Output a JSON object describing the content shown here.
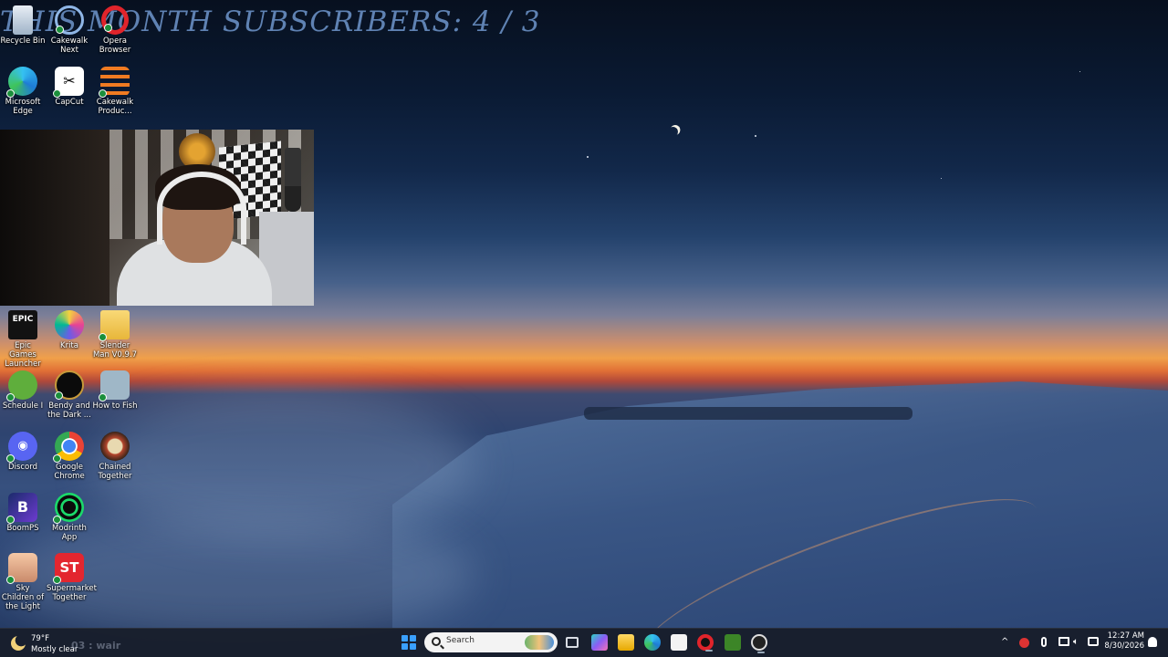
{
  "overlay": {
    "subscribers_text": "THIS MONTH SUBSCRIBERS: 4 / 3"
  },
  "desktop_icons": [
    {
      "label": "Recycle Bin",
      "icon": "recycle-bin-icon"
    },
    {
      "label": "Cakewalk Next",
      "icon": "cakewalk-next-icon"
    },
    {
      "label": "Opera Browser",
      "icon": "opera-icon"
    },
    {
      "label": "Microsoft Edge",
      "icon": "edge-icon"
    },
    {
      "label": "CapCut",
      "icon": "capcut-icon"
    },
    {
      "label": "Cakewalk Produc...",
      "icon": "cakewalk-producer-icon"
    },
    {
      "label": "Epic Games Launcher",
      "icon": "epic-games-icon"
    },
    {
      "label": "Krita",
      "icon": "krita-icon"
    },
    {
      "label": "Slender Man V0.9.7",
      "icon": "folder-icon"
    },
    {
      "label": "Schedule I",
      "icon": "schedule-i-icon"
    },
    {
      "label": "Bendy and the Dark ...",
      "icon": "bendy-icon"
    },
    {
      "label": "How to Fish",
      "icon": "how-to-fish-icon"
    },
    {
      "label": "Discord",
      "icon": "discord-icon"
    },
    {
      "label": "Google Chrome",
      "icon": "chrome-icon"
    },
    {
      "label": "Chained Together",
      "icon": "chained-together-icon"
    },
    {
      "label": "BoomPS",
      "icon": "boomps-icon"
    },
    {
      "label": "Modrinth App",
      "icon": "modrinth-icon"
    },
    {
      "label": "Sky Children of the Light",
      "icon": "sky-icon"
    },
    {
      "label": "Supermarket Together",
      "icon": "supermarket-together-icon"
    }
  ],
  "taskbar": {
    "weather_temp": "79°F",
    "weather_condition": "Mostly clear",
    "chat_ghost": "03 : wair",
    "search_placeholder": "Search",
    "start_icon": "windows-start-icon",
    "pinned_apps": [
      "task-view-icon",
      "copilot-icon",
      "file-explorer-icon",
      "edge-icon",
      "store-icon",
      "opera-gx-icon",
      "minecraft-icon",
      "obs-icon"
    ],
    "tray_chevron": "^",
    "time": "12:27 AM",
    "date": "8/30/2026"
  },
  "colors": {
    "taskbar_bg": "#181e2c",
    "overlay_text": "#6e96cd",
    "start_accent": "#3aa0ff"
  }
}
